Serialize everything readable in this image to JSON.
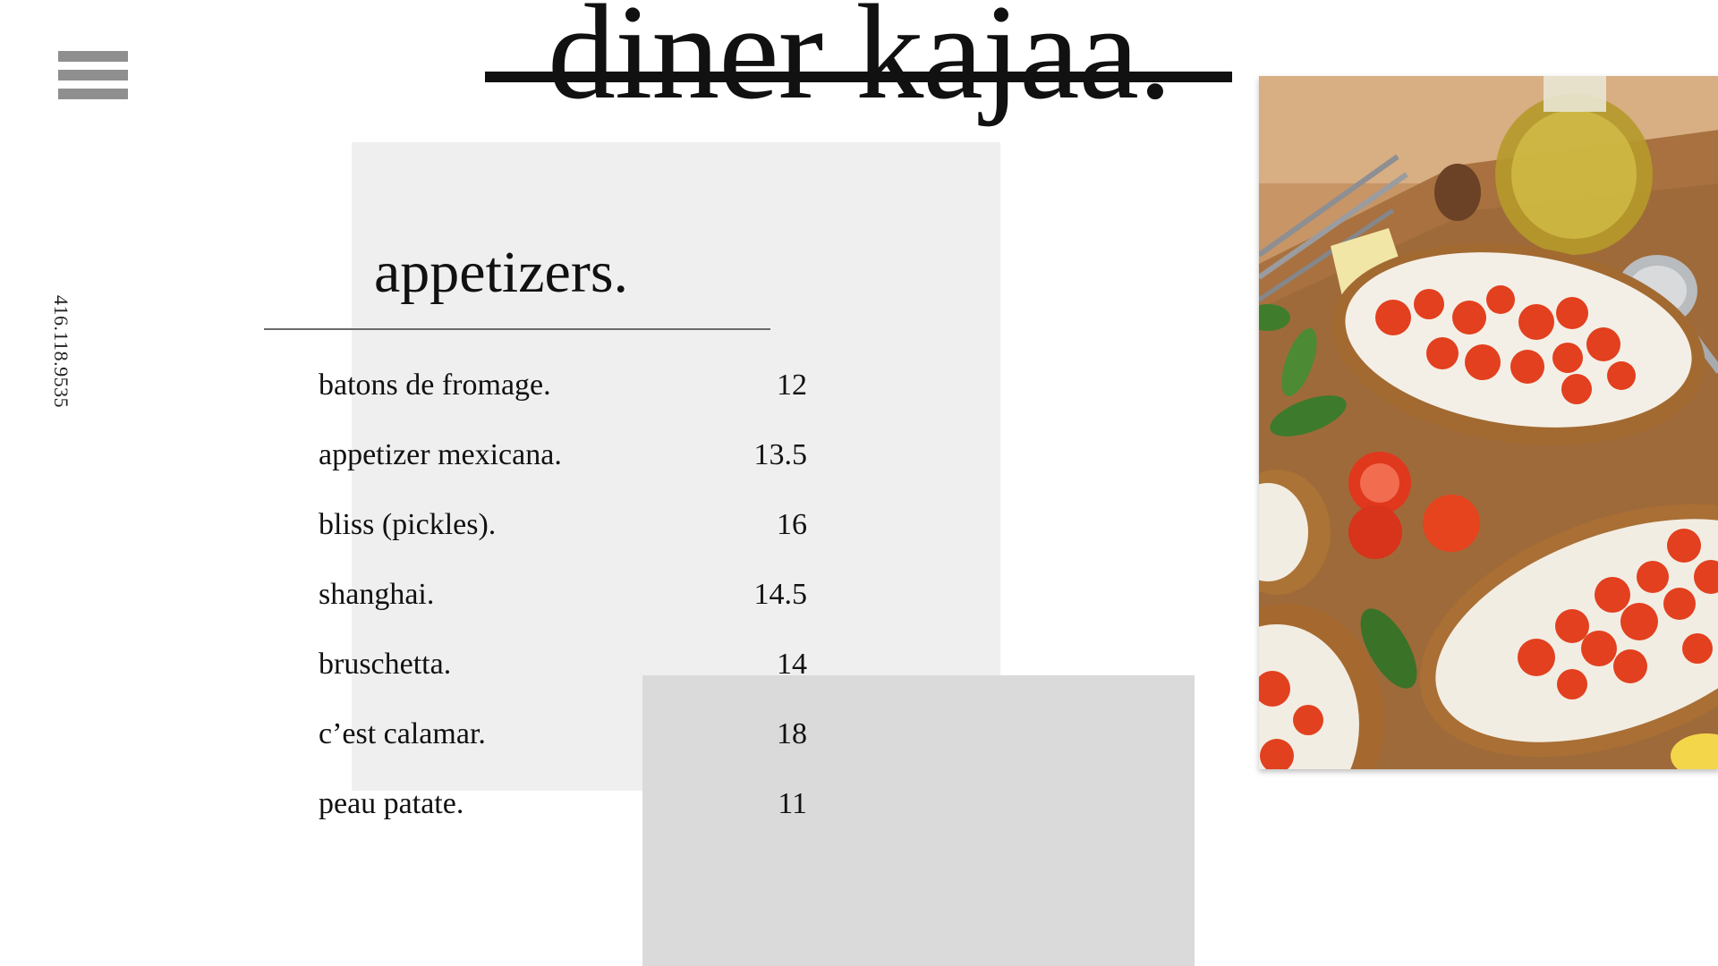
{
  "brand": {
    "name": "diner kajaa."
  },
  "contact": {
    "phone": "416.118.9535"
  },
  "menu_section": {
    "title": "appetizers.",
    "items": [
      {
        "name": "batons de fromage.",
        "price": "12"
      },
      {
        "name": "appetizer mexicana.",
        "price": "13.5"
      },
      {
        "name": "bliss (pickles).",
        "price": "16"
      },
      {
        "name": "shanghai.",
        "price": "14.5"
      },
      {
        "name": "bruschetta.",
        "price": "14"
      },
      {
        "name": "c’est calamar.",
        "price": "18"
      },
      {
        "name": "peau patate.",
        "price": "11"
      }
    ]
  },
  "icons": {
    "menu": "hamburger-menu-icon"
  },
  "colors": {
    "panel_light": "#efefef",
    "panel_dark": "#dadada",
    "menu_icon": "#8f8f8f",
    "text": "#111111"
  }
}
